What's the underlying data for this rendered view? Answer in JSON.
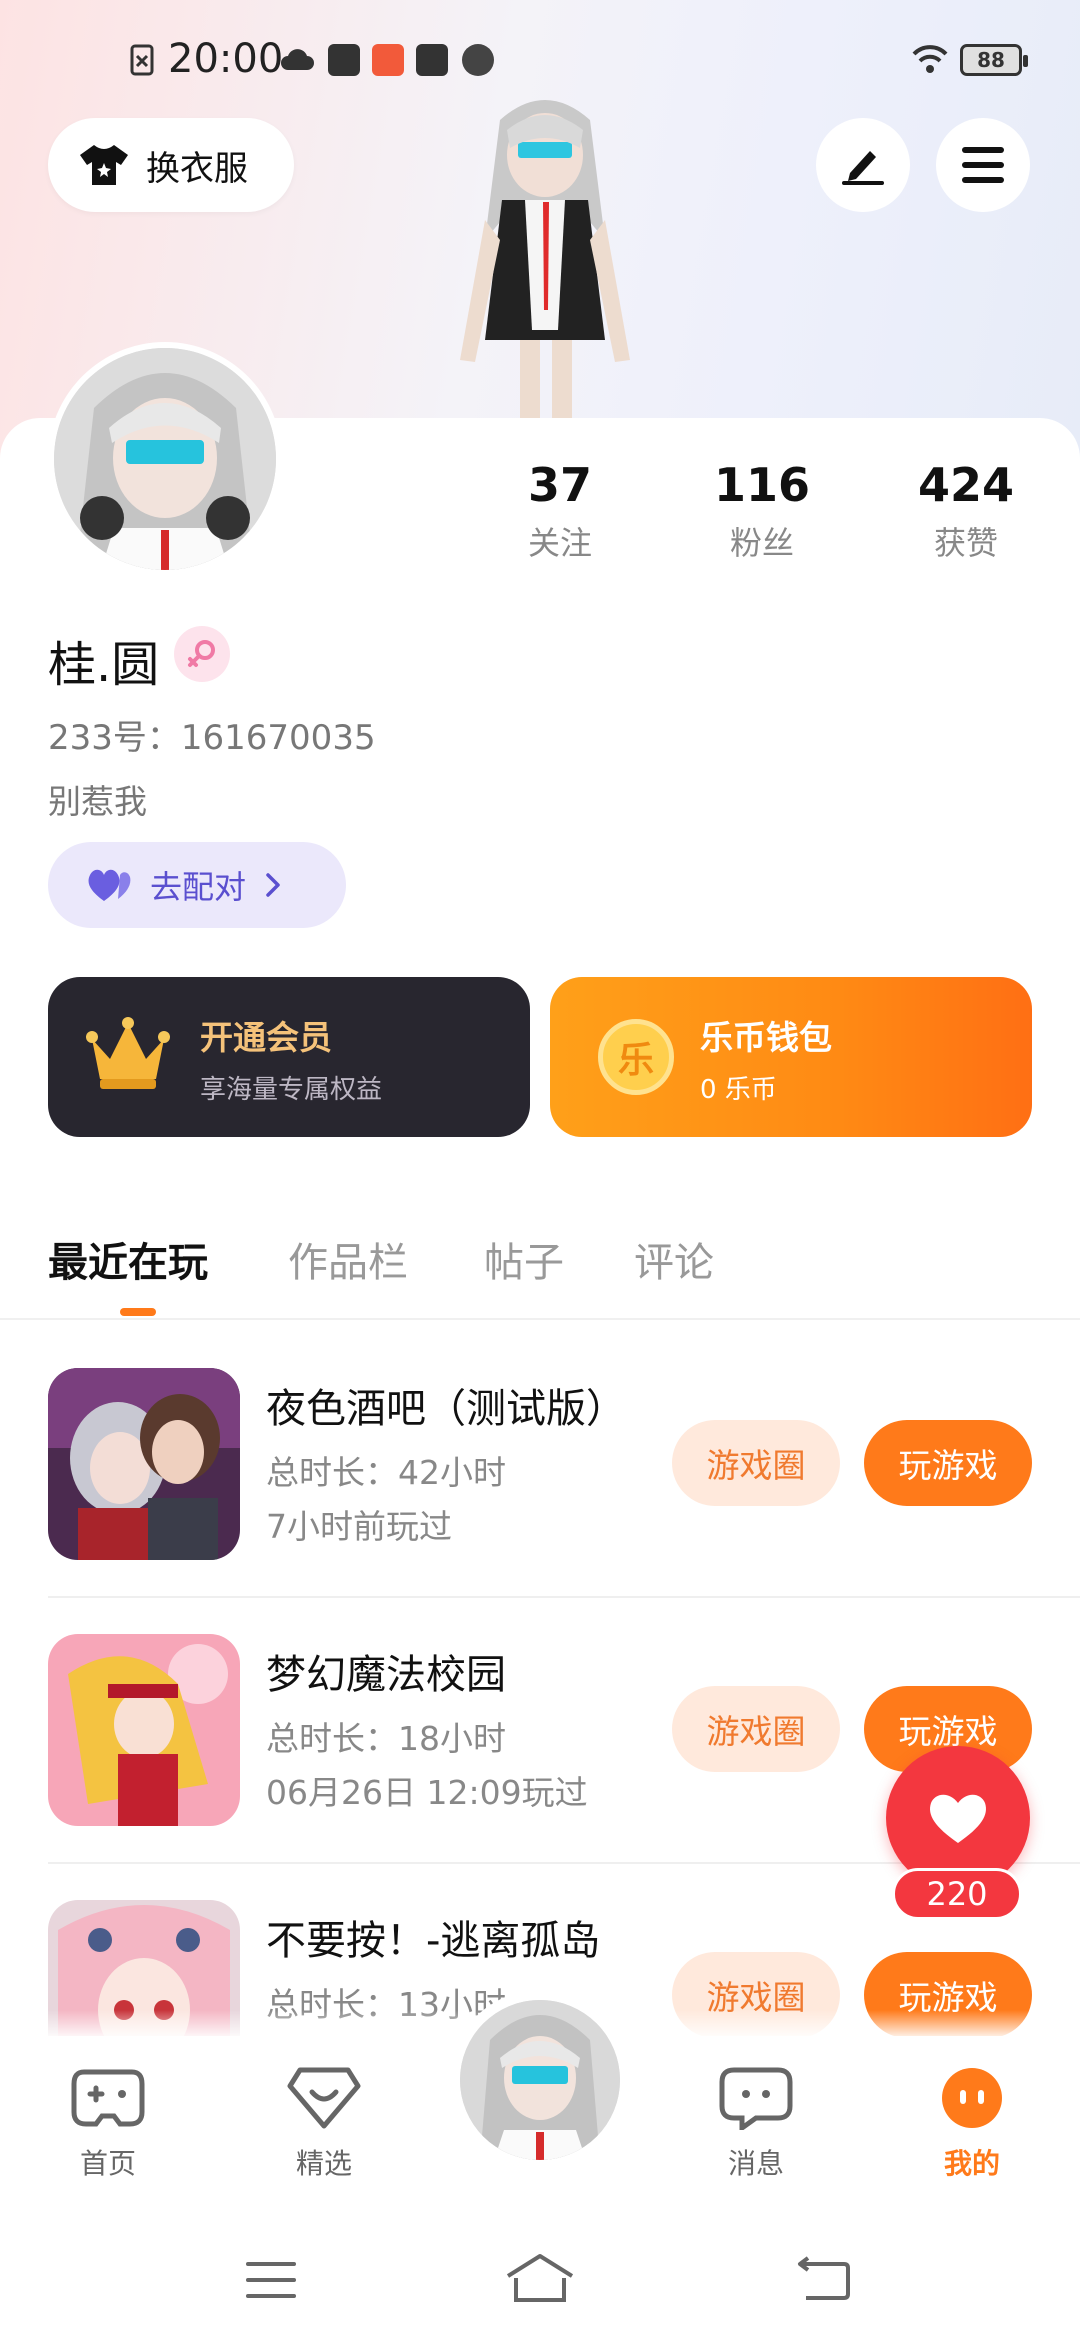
{
  "status_bar": {
    "time": "20:00",
    "battery": "88"
  },
  "header": {
    "outfit_label": "换衣服"
  },
  "profile": {
    "name": "桂.圆",
    "id_line": "233号：161670035",
    "bio": "别惹我",
    "match_label": "去配对",
    "stats": [
      {
        "value": "37",
        "label": "关注"
      },
      {
        "value": "116",
        "label": "粉丝"
      },
      {
        "value": "424",
        "label": "获赞"
      }
    ]
  },
  "vip": {
    "title": "开通会员",
    "subtitle": "享海量专属权益"
  },
  "wallet": {
    "title": "乐币钱包",
    "subtitle": "0 乐币",
    "coin_char": "乐"
  },
  "tabs": [
    "最近在玩",
    "作品栏",
    "帖子",
    "评论"
  ],
  "games": [
    {
      "title": "夜色酒吧（测试版）",
      "line1": "总时长：42小时",
      "line2": "7小时前玩过",
      "circle_btn": "游戏圈",
      "play_btn": "玩游戏"
    },
    {
      "title": "梦幻魔法校园",
      "line1": "总时长：18小时",
      "line2": "06月26日 12:09玩过",
      "circle_btn": "游戏圈",
      "play_btn": "玩游戏"
    },
    {
      "title": "不要按！-逃离孤岛",
      "line1": "总时长：13小时",
      "line2": "",
      "circle_btn": "游戏圈",
      "play_btn": "玩游戏"
    }
  ],
  "float_like": {
    "count": "220"
  },
  "bottom_nav": [
    {
      "label": "首页"
    },
    {
      "label": "精选"
    },
    {
      "label": "消息"
    },
    {
      "label": "我的"
    }
  ],
  "colors": {
    "accent": "#ff7a1a",
    "like_red": "#f3373f",
    "match_purple": "#5a4fcf"
  }
}
